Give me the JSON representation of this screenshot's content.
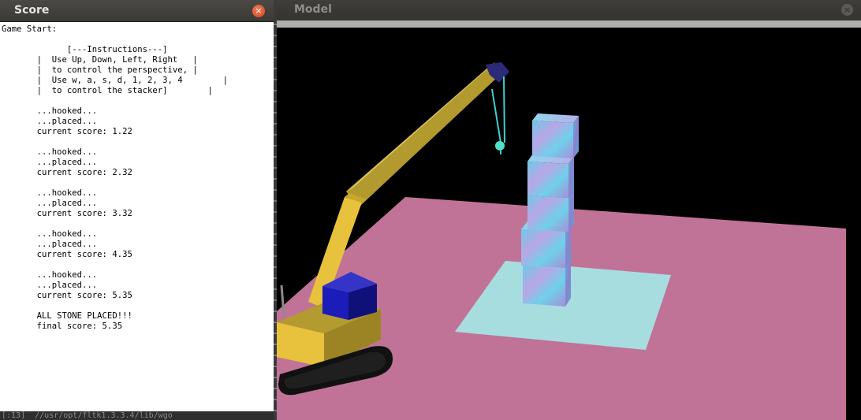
{
  "score_window": {
    "title": "Score",
    "close_glyph": "×",
    "log_text": "Game Start:\n\n             [---Instructions---]\n       |  Use Up, Down, Left, Right   |\n       |  to control the perspective, |\n       |  Use w, a, s, d, 1, 2, 3, 4        |\n       |  to control the stacker]        |\n\n       ...hooked...\n       ...placed...\n       current score: 1.22\n\n       ...hooked...\n       ...placed...\n       current score: 2.32\n\n       ...hooked...\n       ...placed...\n       current score: 3.32\n\n       ...hooked...\n       ...placed...\n       current score: 4.35\n\n       ...hooked...\n       ...placed...\n       current score: 5.35\n\n       ALL STONE PLACED!!!\n       final score: 5.35",
    "bottom_text": "[:13]  //usr/opt/fltk1.3.3.4/lib/wgo"
  },
  "model_window": {
    "title": "Model",
    "close_glyph": "×"
  },
  "scene": {
    "floor_color": "#c07397",
    "target_pad_color": "#a8dde0",
    "crane_body_color": "#e8c23d",
    "cab_color": "#1c1cb8",
    "track_color": "#111111",
    "cable_color": "#3fd0d0",
    "block_color": "#7fc7e6",
    "stacked_blocks": 5
  }
}
